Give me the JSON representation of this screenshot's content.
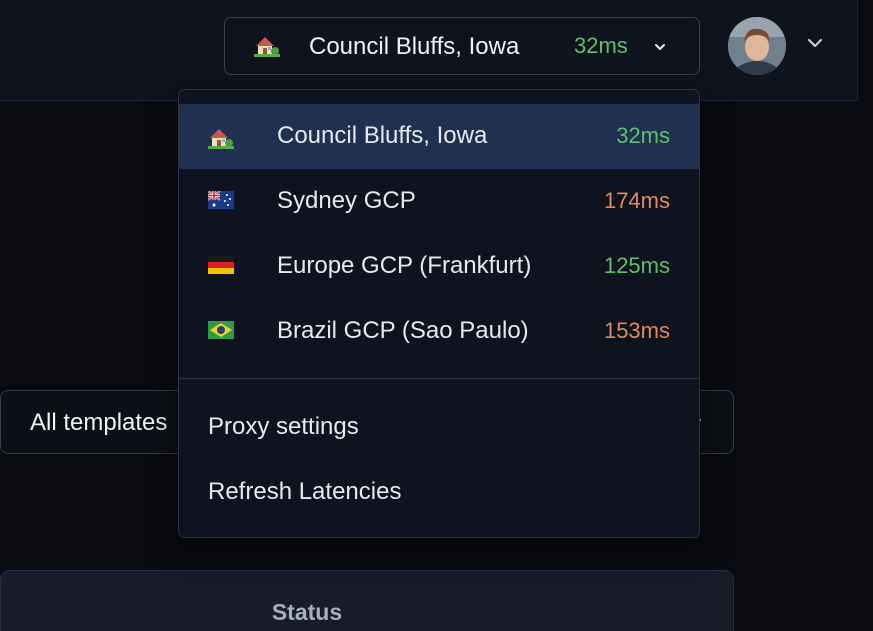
{
  "colors": {
    "latency_good": "#5cc06c",
    "latency_slow": "#e08a5b"
  },
  "proxy": {
    "icon": "house-with-garden-icon",
    "current_name": "Council Bluffs, Iowa",
    "current_latency": "32ms"
  },
  "user": {
    "avatar": "avatar"
  },
  "dropdown": {
    "regions": [
      {
        "flag": "house-with-garden-icon",
        "name": "Council Bluffs, Iowa",
        "latency": "32ms",
        "status": "good",
        "selected": true
      },
      {
        "flag": "australia-flag-icon",
        "name": "Sydney GCP",
        "latency": "174ms",
        "status": "slow",
        "selected": false
      },
      {
        "flag": "germany-flag-icon",
        "name": "Europe GCP (Frankfurt)",
        "latency": "125ms",
        "status": "good",
        "selected": false
      },
      {
        "flag": "brazil-flag-icon",
        "name": "Brazil GCP (Sao Paulo)",
        "latency": "153ms",
        "status": "slow",
        "selected": false
      }
    ],
    "actions": {
      "proxy_settings": "Proxy settings",
      "refresh_latencies": "Refresh Latencies"
    }
  },
  "templates": {
    "filter_label": "All templates"
  },
  "table": {
    "columns": {
      "status": "Status"
    }
  }
}
